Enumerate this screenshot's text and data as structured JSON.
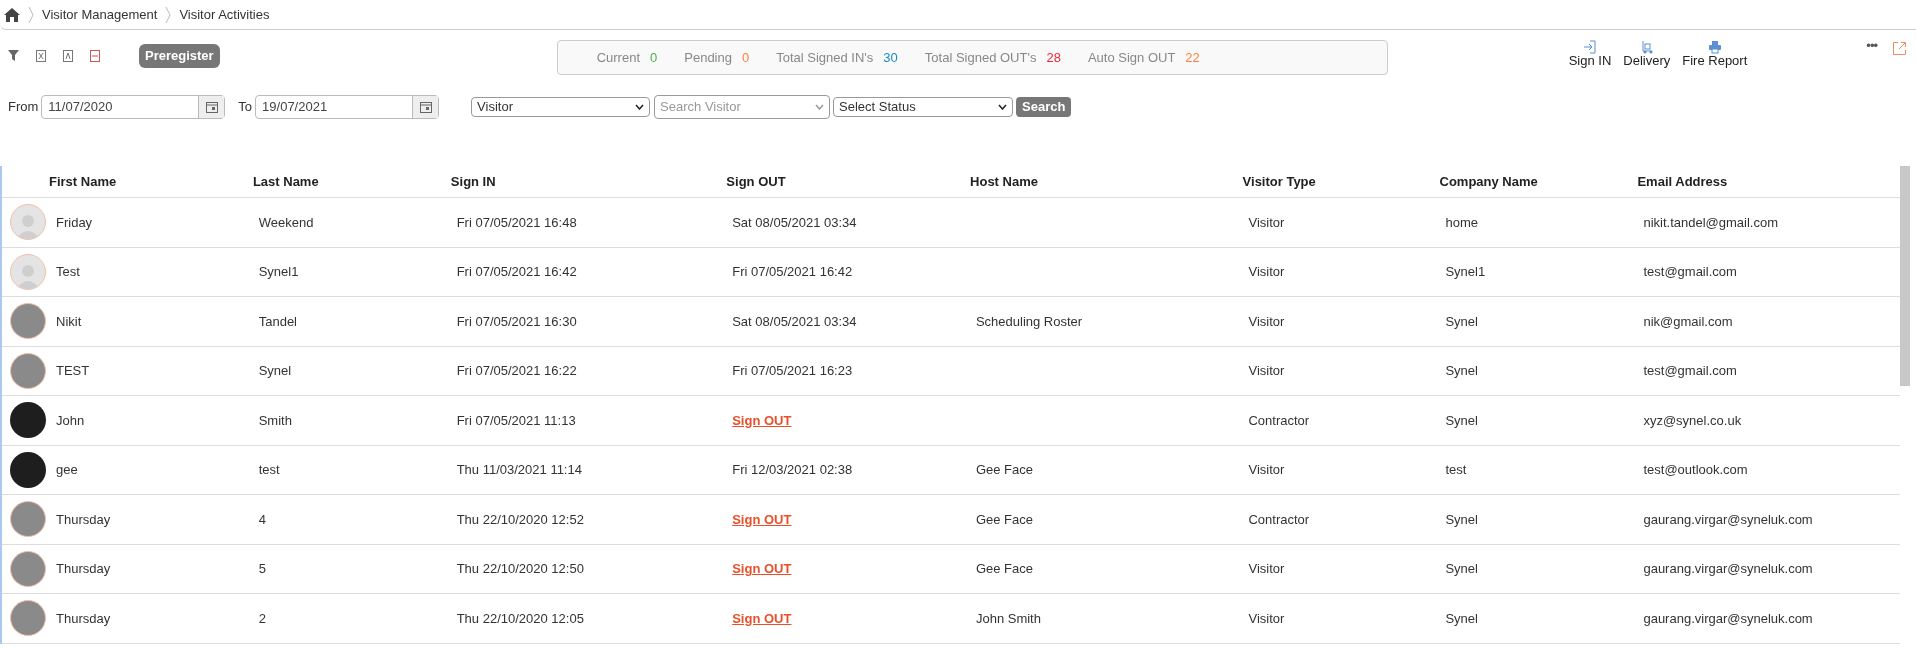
{
  "breadcrumb": [
    "Visitor Management",
    "Visitor Activities"
  ],
  "toolbar": {
    "button": "Preregister"
  },
  "stats": [
    {
      "label": "Current",
      "value": "0",
      "color": "#4caf50"
    },
    {
      "label": "Pending",
      "value": "0",
      "color": "#ff7f3f"
    },
    {
      "label": "Total Signed IN's",
      "value": "30",
      "color": "#1e88c8"
    },
    {
      "label": "Total Signed OUT's",
      "value": "28",
      "color": "#f0263c"
    },
    {
      "label": "Auto Sign OUT",
      "value": "22",
      "color": "#ff7f3f"
    }
  ],
  "more_menu": "•••",
  "actions": [
    {
      "label": "Sign IN",
      "kind": "signin"
    },
    {
      "label": "Delivery",
      "kind": "delivery"
    },
    {
      "label": "Fire Report",
      "kind": "print"
    }
  ],
  "filters": {
    "from_label": "From",
    "from": "11/07/2020",
    "to_label": "To",
    "to": "19/07/2021",
    "type": "Visitor",
    "search_placeholder": "Search Visitor",
    "status": "Select Status",
    "search_button": "Search"
  },
  "table": {
    "columns": [
      "First Name",
      "Last Name",
      "Sign IN",
      "Sign OUT",
      "Host Name",
      "Visitor Type",
      "Company Name",
      "Email Address"
    ],
    "rows": [
      {
        "kind": "silhouette",
        "cells": [
          "Friday",
          "Weekend",
          "Fri 07/05/2021 16:48",
          "Sat 08/05/2021 03:34",
          "",
          "Visitor",
          "home",
          "nikit.tandel@gmail.com"
        ],
        "sign_out_link": false
      },
      {
        "kind": "silhouette",
        "cells": [
          "Test",
          "Synel1",
          "Fri 07/05/2021 16:42",
          "Fri 07/05/2021 16:42",
          "",
          "Visitor",
          "Synel1",
          "test@gmail.com"
        ],
        "sign_out_link": false
      },
      {
        "kind": "photo",
        "cells": [
          "Nikit",
          "Tandel",
          "Fri 07/05/2021 16:30",
          "Sat 08/05/2021 03:34",
          "Scheduling Roster",
          "Visitor",
          "Synel",
          "nik@gmail.com"
        ],
        "sign_out_link": false
      },
      {
        "kind": "photo",
        "cells": [
          "TEST",
          "Synel",
          "Fri 07/05/2021 16:22",
          "Fri 07/05/2021 16:23",
          "",
          "Visitor",
          "Synel",
          "test@gmail.com"
        ],
        "sign_out_link": false
      },
      {
        "kind": "dark",
        "cells": [
          "John",
          "Smith",
          "Fri 07/05/2021 11:13",
          "Sign OUT",
          "",
          "Contractor",
          "Synel",
          "xyz@synel.co.uk"
        ],
        "sign_out_link": true
      },
      {
        "kind": "dark",
        "cells": [
          "gee",
          "test",
          "Thu 11/03/2021 11:14",
          "Fri 12/03/2021 02:38",
          "Gee Face",
          "Visitor",
          "test",
          "test@outlook.com"
        ],
        "sign_out_link": false
      },
      {
        "kind": "photo",
        "cells": [
          "Thursday",
          "4",
          "Thu 22/10/2020 12:52",
          "Sign OUT",
          "Gee Face",
          "Contractor",
          "Synel",
          "gaurang.virgar@syneluk.com"
        ],
        "sign_out_link": true
      },
      {
        "kind": "photo",
        "cells": [
          "Thursday",
          "5",
          "Thu 22/10/2020 12:50",
          "Sign OUT",
          "Gee Face",
          "Visitor",
          "Synel",
          "gaurang.virgar@syneluk.com"
        ],
        "sign_out_link": true
      },
      {
        "kind": "photo",
        "cells": [
          "Thursday",
          "2",
          "Thu 22/10/2020 12:05",
          "Sign OUT",
          "John Smith",
          "Visitor",
          "Synel",
          "gaurang.virgar@syneluk.com"
        ],
        "sign_out_link": true
      }
    ]
  }
}
